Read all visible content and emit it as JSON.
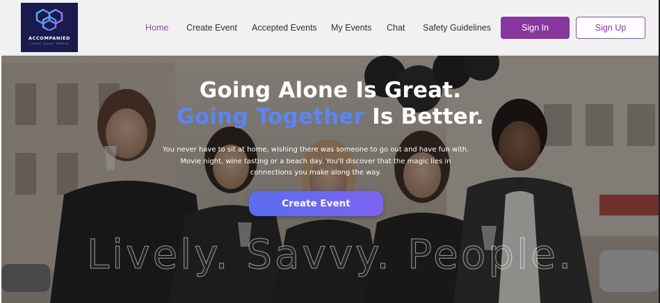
{
  "brand": {
    "name": "ACCOMPANIED",
    "tagline": "LIVELY. SAVVY. PEOPLE"
  },
  "nav": {
    "items": [
      {
        "label": "Home",
        "active": true
      },
      {
        "label": "Create Event",
        "active": false
      },
      {
        "label": "Accepted Events",
        "active": false
      },
      {
        "label": "My Events",
        "active": false
      },
      {
        "label": "Chat",
        "active": false
      },
      {
        "label": "Safety Guidelines",
        "active": false
      }
    ],
    "sign_in": "Sign In",
    "sign_up": "Sign Up"
  },
  "hero": {
    "headline_line1": "Going Alone Is Great.",
    "headline_line2_accent": "Going Together",
    "headline_line2_rest": " Is Better.",
    "subtext_line1": "You never have to sit at home, wishing there was someone to go out and have fun with.",
    "subtext_line2": "Movie night, wine tasting or a beach day. You'll discover that the magic lies in",
    "subtext_line3": "connections you make along the way.",
    "cta": "Create Event",
    "watermark": "Lively. Savvy. People."
  },
  "colors": {
    "brand_purple": "#85379b",
    "active_nav": "#8a4fa5",
    "accent_blue": "#5a86f4",
    "logo_bg": "#1b1a4d",
    "cta_gradient_start": "#5b6df0",
    "cta_gradient_end": "#7c63ef"
  }
}
